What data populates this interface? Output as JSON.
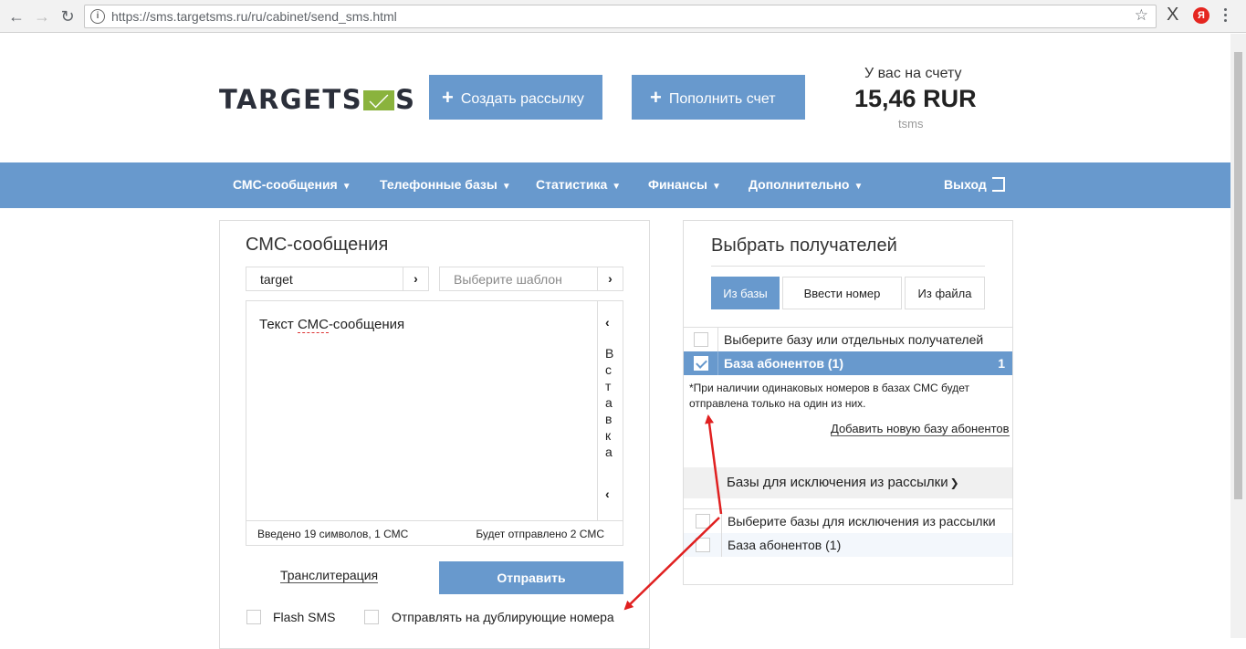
{
  "browser": {
    "url": "https://sms.targetsms.ru/ru/cabinet/send_sms.html",
    "ext_x_label": "X",
    "ext_yandex_label": "Я"
  },
  "header": {
    "logo_left": "TARGETS",
    "logo_right": "S",
    "create_button": "Создать рассылку",
    "topup_button": "Пополнить счет",
    "balance_label": "У вас на счету",
    "balance_value": "15,46 RUR",
    "balance_unit": "tsms"
  },
  "nav": {
    "items": [
      "СМС-сообщения",
      "Телефонные базы",
      "Статистика",
      "Финансы",
      "Дополнительно"
    ],
    "exit": "Выход"
  },
  "sms_panel": {
    "title": "СМС-сообщения",
    "sender_value": "target",
    "template_placeholder": "Выберите шаблон",
    "message_text_a": "Текст ",
    "message_text_b": "СМС",
    "message_text_c": "-сообщения",
    "insert_label": "Вставка",
    "counter_left": "Введено 19 символов, 1 СМС",
    "counter_right": "Будет отправлено 2 СМС",
    "translit": "Транслитерация",
    "send_button": "Отправить",
    "flash_label": "Flash SMS",
    "dup_label": "Отправлять на дублирующие номера"
  },
  "recipients_panel": {
    "title": "Выбрать получателей",
    "tabs": [
      "Из базы",
      "Ввести номер",
      "Из файла"
    ],
    "select_all": "Выберите базу или отдельных получателей",
    "base_name": "База абонентов (1)",
    "base_count": "1",
    "note": "*При наличии одинаковых номеров в базах СМС будет отправлена только на один из них.",
    "add_base_link": "Добавить новую базу абонентов",
    "exclusions_header": "Базы для исключения из рассылки",
    "exclusions_select": "Выберите базы для исключения из рассылки",
    "exclusions_base": "База абонентов (1)"
  },
  "colors": {
    "accent": "#6899cd",
    "arrow": "#e02020",
    "logo_green": "#8ab33d"
  }
}
